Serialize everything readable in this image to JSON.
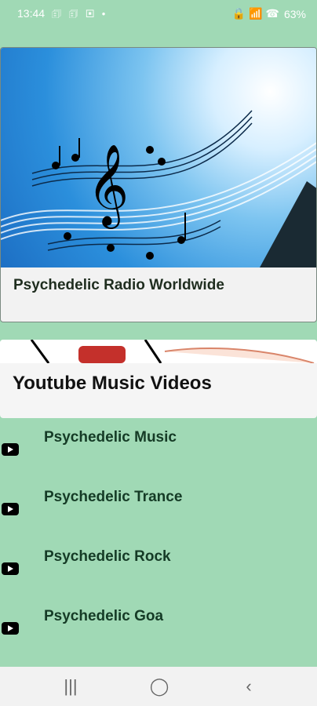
{
  "status": {
    "time": "13:44",
    "left_icons": "🗊 🗊 ▣ •",
    "right_icons": "🔒 📶 ☎",
    "battery": "63%"
  },
  "cards": [
    {
      "title": "Psychedelic Radio Worldwide"
    },
    {
      "title": "Youtube Music Videos"
    }
  ],
  "list": [
    {
      "label": "Psychedelic Music"
    },
    {
      "label": "Psychedelic Trance"
    },
    {
      "label": "Psychedelic Rock"
    },
    {
      "label": "Psychedelic Goa"
    }
  ],
  "nav": {
    "recent": "|||",
    "home": "◯",
    "back": "‹"
  },
  "colors": {
    "background": "#a0d9b5",
    "card": "#f2f2f2",
    "text_green": "#153b26"
  }
}
